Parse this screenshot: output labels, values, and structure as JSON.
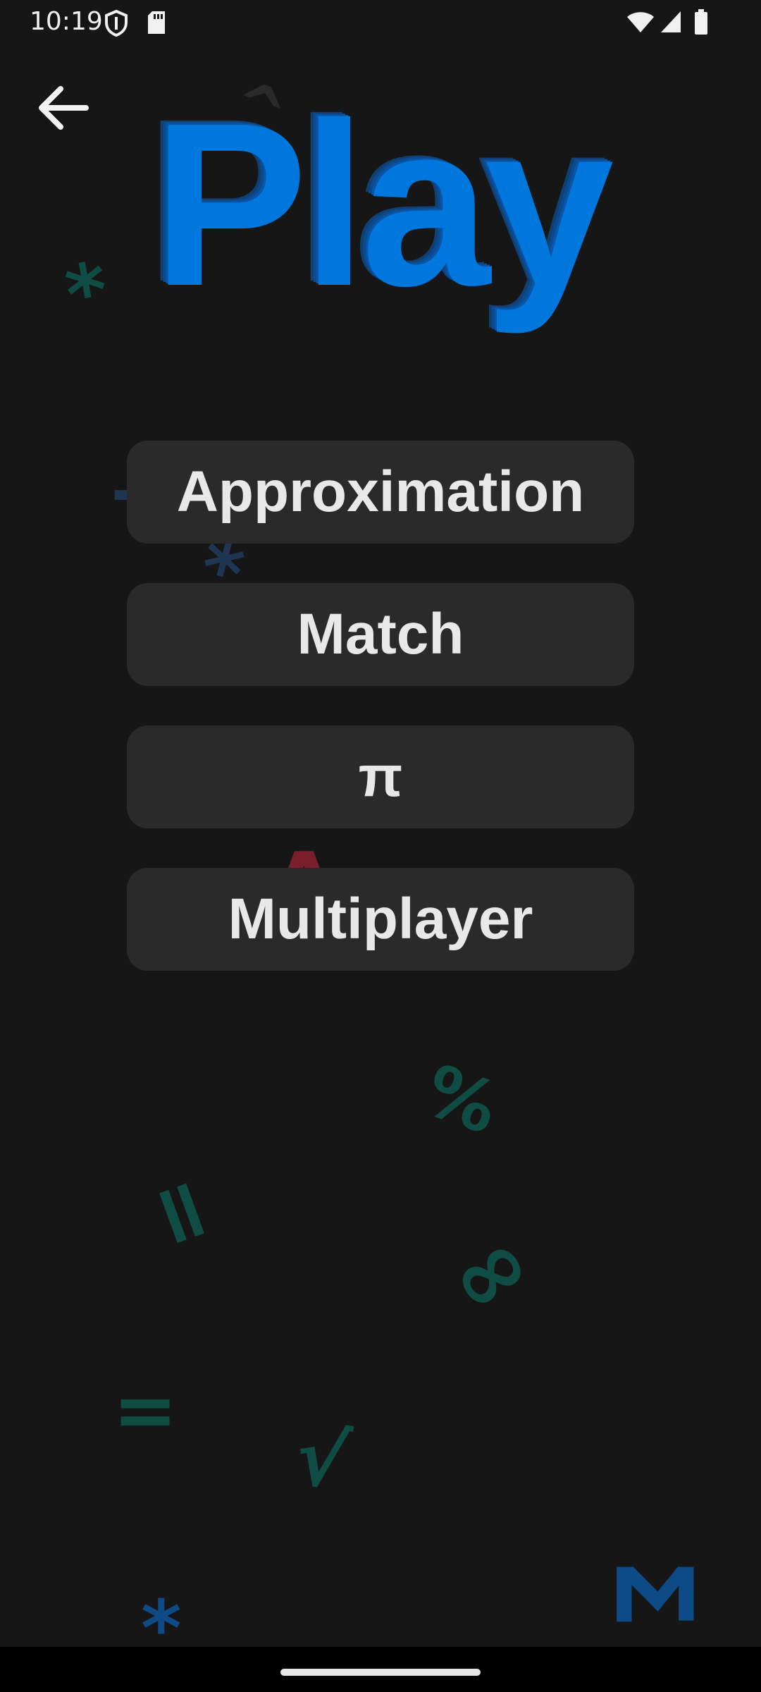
{
  "status_bar": {
    "time": "10:19",
    "icons_left": [
      "shield-icon",
      "sd-card-icon"
    ],
    "icons_right": [
      "wifi-icon",
      "cell-signal-icon",
      "battery-icon"
    ]
  },
  "nav": {
    "back_icon": "arrow-left-icon"
  },
  "title": "Play",
  "menu": {
    "approximation": "Approximation",
    "match": "Match",
    "pi": "π",
    "multiplayer": "Multiplayer"
  },
  "background_symbols": [
    "^",
    "*",
    "+",
    "=",
    "*",
    "Δ",
    "%",
    "=",
    "∞",
    "=",
    "√",
    "*",
    "Σ"
  ],
  "colors": {
    "background": "#161616",
    "title": "#0077dd",
    "button": "#2a2a2a",
    "button_text": "#e8e8e8"
  }
}
